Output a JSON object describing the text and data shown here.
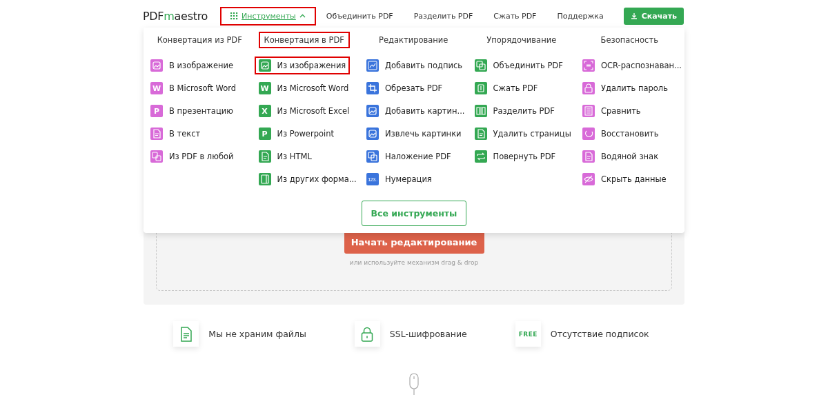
{
  "header": {
    "logo": {
      "first": "PDF",
      "rest": "maestro"
    },
    "nav": [
      {
        "label": "Инструменты",
        "kind": "dropdown",
        "expanded": true,
        "highlighted": true
      },
      {
        "label": "Объединить PDF",
        "kind": "link",
        "highlighted": false
      },
      {
        "label": "Разделить PDF",
        "kind": "link",
        "highlighted": false
      },
      {
        "label": "Сжать PDF",
        "kind": "link",
        "highlighted": false
      },
      {
        "label": "Поддержка",
        "kind": "link",
        "highlighted": false
      }
    ],
    "download_button": "Скачать"
  },
  "tools_menu": {
    "columns": [
      {
        "title": "Конвертация из PDF",
        "highlighted": false,
        "color": "#d86ad8",
        "items": [
          {
            "label": "В изображение",
            "kind": "image",
            "highlighted": false
          },
          {
            "label": "В Microsoft Word",
            "kind": "letter",
            "glyph": "W",
            "highlighted": false
          },
          {
            "label": "В презентацию",
            "kind": "letter",
            "glyph": "P",
            "highlighted": false
          },
          {
            "label": "В текст",
            "kind": "doc",
            "highlighted": false
          },
          {
            "label": "Из PDF в любой",
            "kind": "multi",
            "highlighted": false
          }
        ]
      },
      {
        "title": "Конвертация в PDF",
        "highlighted": true,
        "color": "#34a853",
        "items": [
          {
            "label": "Из изображения",
            "kind": "image",
            "highlighted": true
          },
          {
            "label": "Из Microsoft Word",
            "kind": "letter",
            "glyph": "W",
            "highlighted": false
          },
          {
            "label": "Из Microsoft Excel",
            "kind": "letter",
            "glyph": "X",
            "highlighted": false
          },
          {
            "label": "Из Powerpoint",
            "kind": "letter",
            "glyph": "P",
            "highlighted": false
          },
          {
            "label": "Из HTML",
            "kind": "doc",
            "highlighted": false
          },
          {
            "label": "Из других форма...",
            "kind": "book",
            "highlighted": false
          }
        ]
      },
      {
        "title": "Редактирование",
        "highlighted": false,
        "color": "#3a74dc",
        "items": [
          {
            "label": "Добавить подпись",
            "kind": "sign",
            "highlighted": false
          },
          {
            "label": "Обрезать PDF",
            "kind": "crop",
            "highlighted": false
          },
          {
            "label": "Добавить картин...",
            "kind": "image",
            "highlighted": false
          },
          {
            "label": "Извлечь картинки",
            "kind": "image",
            "highlighted": false
          },
          {
            "label": "Наложение PDF",
            "kind": "layers",
            "highlighted": false
          },
          {
            "label": "Нумерация",
            "kind": "letter",
            "glyph": "123..",
            "highlighted": false
          }
        ]
      },
      {
        "title": "Упорядочивание",
        "highlighted": false,
        "color": "#34a853",
        "items": [
          {
            "label": "Объединить PDF",
            "kind": "layers",
            "highlighted": false
          },
          {
            "label": "Сжать PDF",
            "kind": "compress",
            "highlighted": false
          },
          {
            "label": "Разделить PDF",
            "kind": "split",
            "highlighted": false
          },
          {
            "label": "Удалить страницы",
            "kind": "doc",
            "highlighted": false
          },
          {
            "label": "Повернуть PDF",
            "kind": "rotate",
            "highlighted": false
          }
        ]
      },
      {
        "title": "Безопасность",
        "highlighted": false,
        "color": "#d86ad8",
        "items": [
          {
            "label": "OCR-распознаван...",
            "kind": "ocr",
            "highlighted": false
          },
          {
            "label": "Удалить пароль",
            "kind": "lock",
            "highlighted": false
          },
          {
            "label": "Сравнить",
            "kind": "compare",
            "highlighted": false
          },
          {
            "label": "Восстановить",
            "kind": "restore",
            "highlighted": false
          },
          {
            "label": "Водяной знак",
            "kind": "doc",
            "highlighted": false
          },
          {
            "label": "Скрыть данные",
            "kind": "eye",
            "highlighted": false
          }
        ]
      }
    ],
    "all_tools_button": "Все инструменты"
  },
  "upload": {
    "button": "Начать редактирование",
    "hint": "или используйте механизм drag & drop"
  },
  "features": [
    {
      "kind": "file",
      "text": "Мы не храним файлы"
    },
    {
      "kind": "lock",
      "text": "SSL-шифрование"
    },
    {
      "kind": "badge",
      "badge": "FREE",
      "text": "Отсутствие подписок"
    }
  ]
}
